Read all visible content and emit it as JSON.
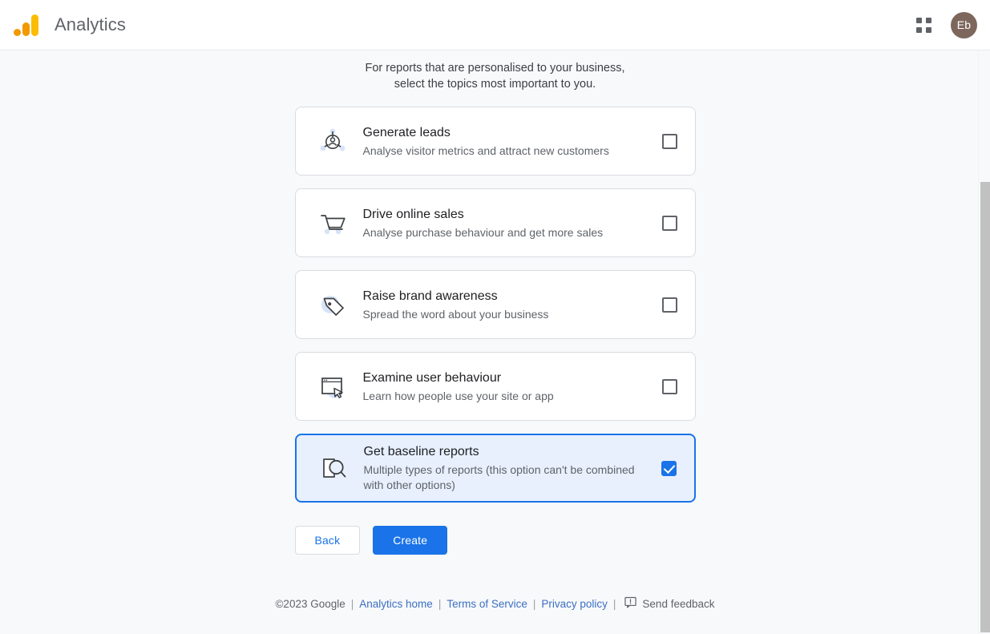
{
  "appbar": {
    "logo_name": "google-analytics-logo",
    "title": "Analytics",
    "apps_icon": "apps-grid-icon",
    "avatar_initials": "Eb"
  },
  "intro": {
    "line1": "For reports that are personalised to your business,",
    "line2": "select the topics most important to you."
  },
  "cards": [
    {
      "icon": "generate-leads-icon",
      "title": "Generate leads",
      "desc": "Analyse visitor metrics and attract new customers",
      "checked": false
    },
    {
      "icon": "shopping-cart-icon",
      "title": "Drive online sales",
      "desc": "Analyse purchase behaviour and get more sales",
      "checked": false
    },
    {
      "icon": "price-tag-icon",
      "title": "Raise brand awareness",
      "desc": "Spread the word about your business",
      "checked": false
    },
    {
      "icon": "browser-cursor-icon",
      "title": "Examine user behaviour",
      "desc": "Learn how people use your site or app",
      "checked": false
    },
    {
      "icon": "document-search-icon",
      "title": "Get baseline reports",
      "desc": "Multiple types of reports (this option can't be combined with other options)",
      "checked": true
    }
  ],
  "actions": {
    "back_label": "Back",
    "create_label": "Create"
  },
  "footer": {
    "copyright": "©2023 Google",
    "sep": "|",
    "analytics_home": "Analytics home",
    "terms": "Terms of Service",
    "privacy": "Privacy policy",
    "feedback_icon": "feedback-bubble-icon",
    "feedback": "Send feedback"
  },
  "colors": {
    "accent_blue": "#1a73e8",
    "selected_bg": "#e8f0fe",
    "page_bg": "#f8f9fa",
    "logo_orange": "#f29900",
    "logo_yellow": "#fbbc04",
    "avatar_bg": "#7d675d",
    "link_blue": "#3c6fc4"
  }
}
